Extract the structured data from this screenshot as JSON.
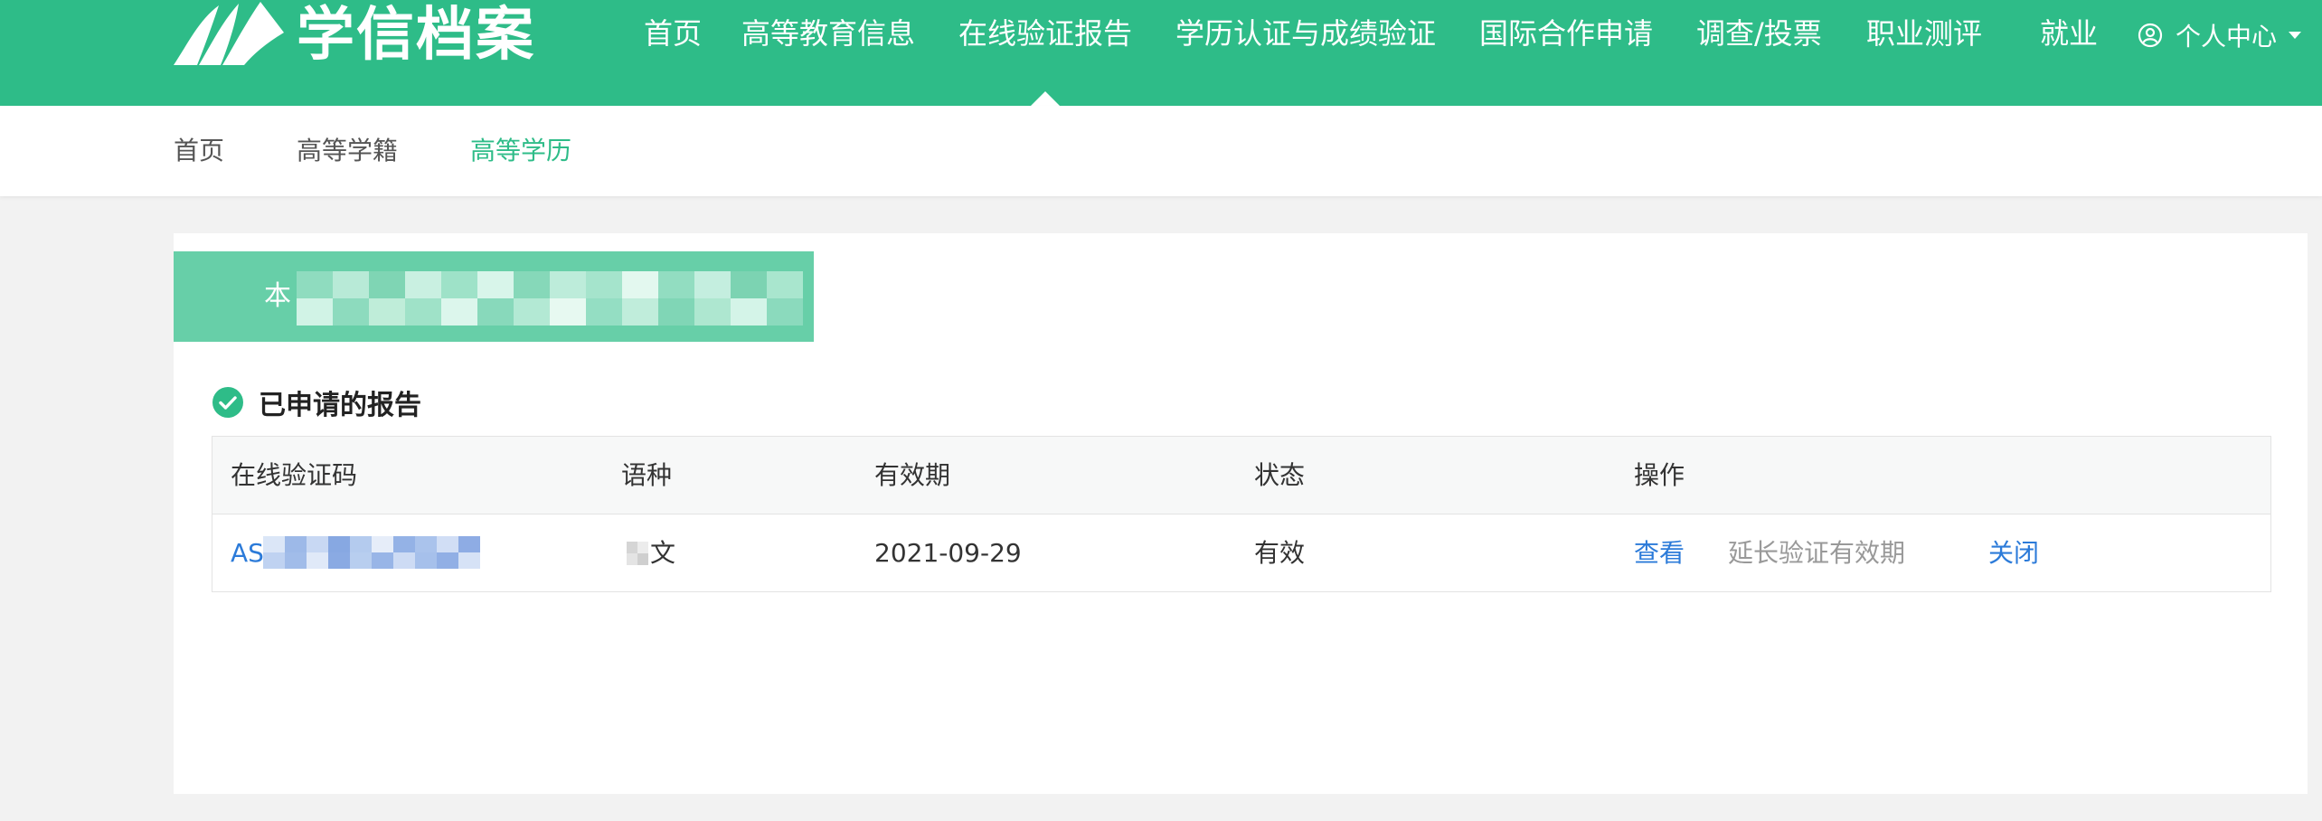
{
  "brand": {
    "logo_text": "学信档案"
  },
  "main_nav": {
    "items": [
      {
        "label": "首页"
      },
      {
        "label": "高等教育信息"
      },
      {
        "label": "在线验证报告"
      },
      {
        "label": "学历认证与成绩验证"
      },
      {
        "label": "国际合作申请"
      },
      {
        "label": "调查/投票"
      },
      {
        "label": "职业测评"
      },
      {
        "label": "就业"
      }
    ],
    "active_index": 2,
    "user_center": "个人中心"
  },
  "sub_nav": {
    "items": [
      {
        "label": "首页"
      },
      {
        "label": "高等学籍"
      },
      {
        "label": "高等学历"
      }
    ],
    "active_index": 2
  },
  "banner": {
    "text_prefix": "本"
  },
  "reports": {
    "title": "已申请的报告",
    "columns": [
      "在线验证码",
      "语种",
      "有效期",
      "状态",
      "操作"
    ],
    "rows": [
      {
        "code_prefix": "ASI",
        "language_suffix": "文",
        "expiry": "2021-09-29",
        "status": "有效",
        "actions": {
          "view": "查看",
          "extend": "延长验证有效期",
          "close": "关闭"
        }
      }
    ]
  },
  "colors": {
    "brand_green": "#2ebc88",
    "banner_green": "#67cfa8",
    "link_blue": "#2c7bd9",
    "muted_gray": "#999999"
  }
}
